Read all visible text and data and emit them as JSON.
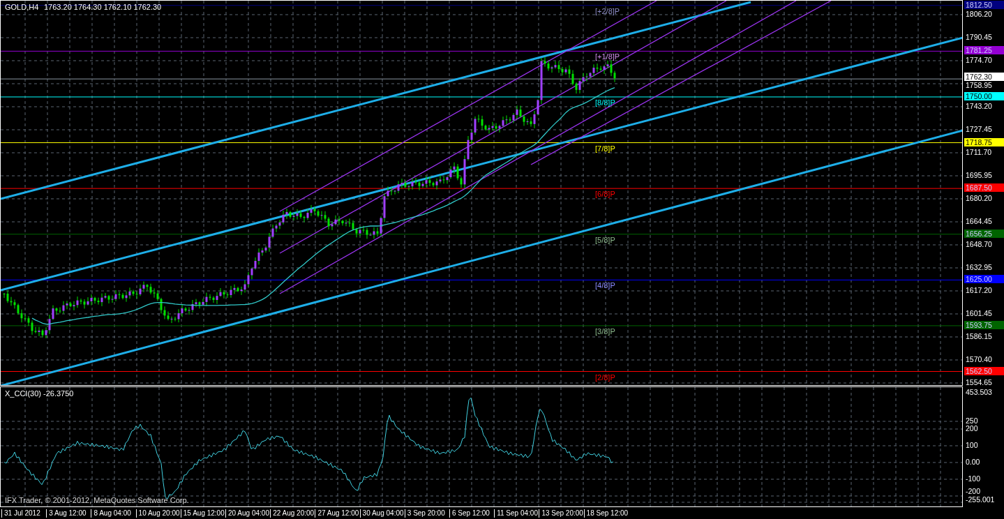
{
  "chart": {
    "title": "GOLD,H4",
    "quote": "1763.20 1764.30 1762.10 1762.30",
    "current_price": "1762.30"
  },
  "murrey_levels": [
    {
      "label": "[+2/8]P",
      "price": "1812.50",
      "color": "#000080"
    },
    {
      "label": "[+1/8]P",
      "price": "1781.25",
      "color": "#9400d3"
    },
    {
      "label": "[8/8]P",
      "price": "1750.00",
      "color": "#00ffff"
    },
    {
      "label": "[7/8]P",
      "price": "1718.75",
      "color": "#ffff00"
    },
    {
      "label": "[6/8]P",
      "price": "1687.50",
      "color": "#ff0000"
    },
    {
      "label": "[5/8]P",
      "price": "1656.25",
      "color": "#006400"
    },
    {
      "label": "[4/8]P",
      "price": "1625.00",
      "color": "#0000ff"
    },
    {
      "label": "[3/8]P",
      "price": "1593.75",
      "color": "#006400"
    },
    {
      "label": "[2/8]P",
      "price": "1562.50",
      "color": "#ff0000"
    }
  ],
  "price_axis": {
    "ticks": [
      "1806.20",
      "1790.45",
      "1774.70",
      "1758.95",
      "1743.20",
      "1727.45",
      "1711.70",
      "1695.95",
      "1680.20",
      "1664.45",
      "1648.70",
      "1632.95",
      "1617.20",
      "1601.45",
      "1586.15",
      "1570.40",
      "1554.65"
    ]
  },
  "indicator": {
    "title": "X_CCI(30) -26.3750",
    "ticks": [
      "453.503",
      "250",
      "200",
      "100",
      "0.00",
      "-100",
      "-200",
      "-255.001"
    ]
  },
  "copyright": "IFX Trader, © 2001-2012, MetaQuotes Software Corp.",
  "time_axis": {
    "ticks": [
      "31 Jul 2012",
      "3 Aug 12:00",
      "8 Aug 04:00",
      "10 Aug 20:00",
      "15 Aug 12:00",
      "20 Aug 04:00",
      "22 Aug 20:00",
      "27 Aug 12:00",
      "30 Aug 04:00",
      "3 Sep 20:00",
      "6 Sep 12:00",
      "11 Sep 04:00",
      "13 Sep 20:00",
      "18 Sep 12:00"
    ]
  }
}
